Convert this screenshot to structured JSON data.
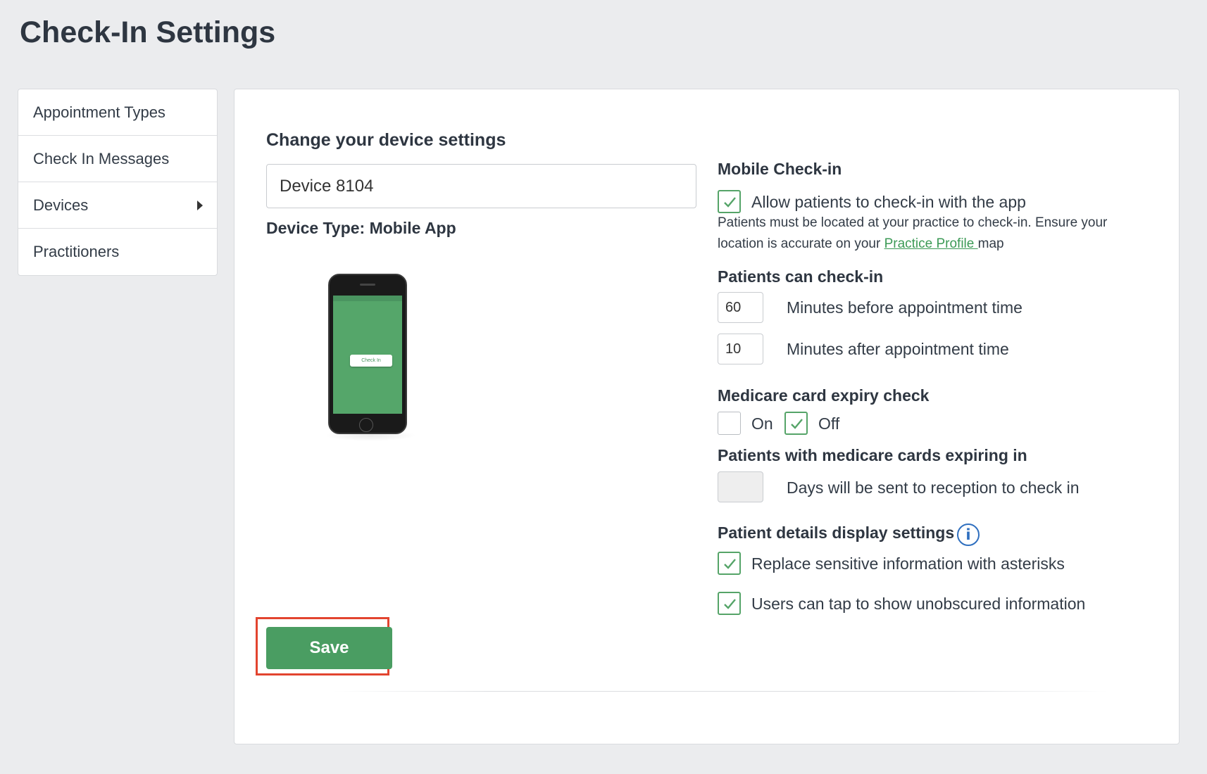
{
  "page": {
    "title": "Check-In Settings"
  },
  "sidebar": {
    "items": [
      {
        "label": "Appointment Types"
      },
      {
        "label": "Check In Messages"
      },
      {
        "label": "Devices"
      },
      {
        "label": "Practitioners"
      }
    ]
  },
  "device": {
    "section_title": "Change your device settings",
    "name_value": "Device 8104",
    "type_label": "Device Type: Mobile App",
    "phone_button": "Check In"
  },
  "mobile_checkin": {
    "title": "Mobile Check-in",
    "allow_label": "Allow patients to check-in with the app",
    "allow_checked": true,
    "help_text": "Patients must be located at your practice to check-in. Ensure your location is accurate on your ",
    "help_link": "Practice Profile ",
    "help_suffix": "map"
  },
  "checkin_window": {
    "title": "Patients can check-in",
    "before_value": "60",
    "before_label": "Minutes before appointment time",
    "after_value": "10",
    "after_label": "Minutes after appointment time"
  },
  "medicare": {
    "title": "Medicare card expiry check",
    "on_label": "On",
    "on_checked": false,
    "off_label": "Off",
    "off_checked": true,
    "expiring_title": "Patients with medicare cards expiring in",
    "days_value": "",
    "days_label": "Days will be sent to reception to check in"
  },
  "patient_display": {
    "title": "Patient details display settings",
    "replace_label": "Replace sensitive information with asterisks",
    "replace_checked": true,
    "tap_label": "Users can tap to show unobscured information",
    "tap_checked": true
  },
  "actions": {
    "save_label": "Save"
  },
  "colors": {
    "accent": "#4a9d62",
    "highlight": "#e2442f",
    "info": "#2f6fbf"
  }
}
